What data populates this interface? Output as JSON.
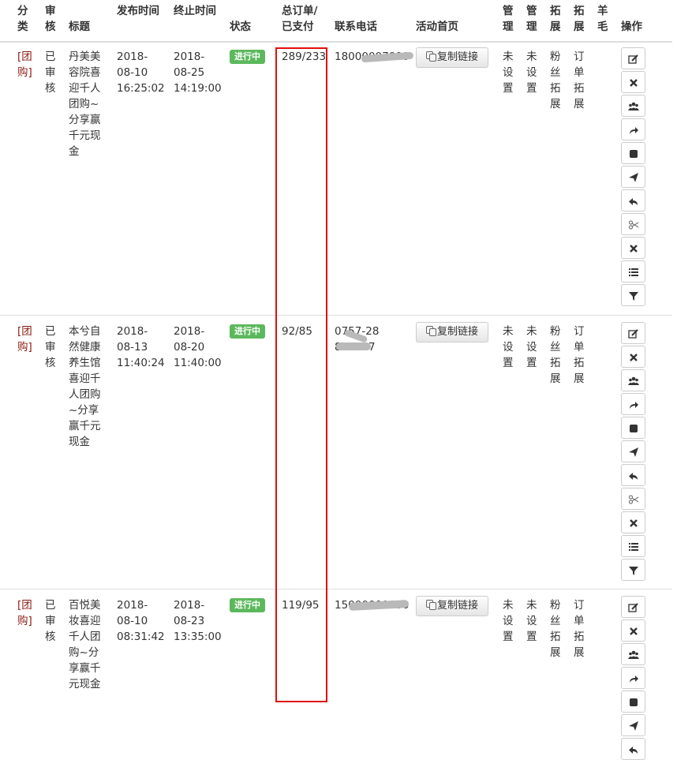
{
  "table": {
    "headers": {
      "category": "分类",
      "audit": "审核",
      "title": "标题",
      "publish_time": "发布时间",
      "end_time": "终止时间",
      "status": "状态",
      "orders": "总订单/已支付",
      "phone": "联系电话",
      "homepage": "活动首页",
      "manage1": "管理",
      "manage2": "管理",
      "expand1": "拓展",
      "expand2": "拓展",
      "wool": "羊毛",
      "actions": "操作"
    },
    "rows": [
      {
        "category": "[团购]",
        "audit": "已审核",
        "title": "丹美美容院喜迎千人团购~分享赢千元现金",
        "publish_time": "2018-08-10 16:25:02",
        "end_time": "2018-08-25 14:19:00",
        "status": "进行中",
        "orders": "289/233",
        "phone": "18000007000",
        "copy_link": "复制链接",
        "manage1": "未设置",
        "manage2": "未设置",
        "expand1": "粉丝拓展",
        "expand2": "订单拓展"
      },
      {
        "category": "[团购]",
        "audit": "已审核",
        "title": "本兮自然健康养生馆喜迎千人团购~分享赢千元现金",
        "publish_time": "2018-08-13 11:40:24",
        "end_time": "2018-08-20 11:40:00",
        "status": "进行中",
        "orders": "92/85",
        "phone": "0757-28888887",
        "copy_link": "复制链接",
        "manage1": "未设置",
        "manage2": "未设置",
        "expand1": "粉丝拓展",
        "expand2": "订单拓展"
      },
      {
        "category": "[团购]",
        "audit": "已审核",
        "title": "百悦美妆喜迎千人团购~分享赢千元现金",
        "publish_time": "2018-08-10 08:31:42",
        "end_time": "2018-08-23 13:35:00",
        "status": "进行中",
        "orders": "119/95",
        "phone": "15000000000",
        "copy_link": "复制链接",
        "manage1": "未设置",
        "manage2": "未设置",
        "expand1": "粉丝拓展",
        "expand2": "订单拓展"
      }
    ],
    "action_icons": [
      "edit-icon",
      "close-icon",
      "users-icon",
      "share-icon",
      "stop-icon",
      "send-icon",
      "reply-icon",
      "scissors-icon",
      "delete-icon",
      "list-icon",
      "filter-icon"
    ]
  },
  "colors": {
    "status_badge": "#5cb85c",
    "category_text": "#8b1a10",
    "highlight_box": "#e01010"
  }
}
